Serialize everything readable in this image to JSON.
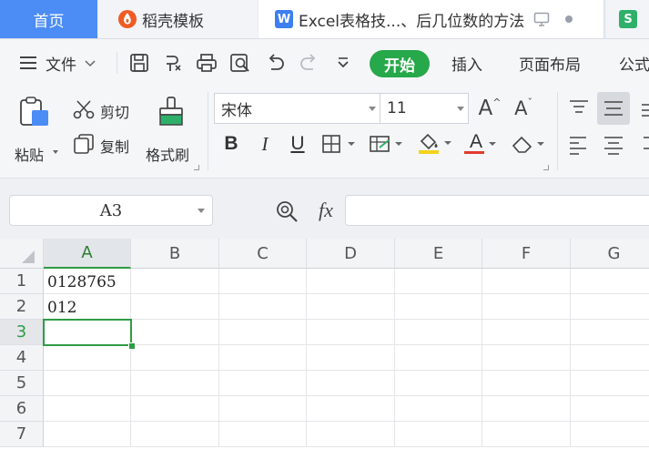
{
  "tabs": [
    {
      "label": "首页"
    },
    {
      "label": "稻壳模板",
      "icon": "daoke-logo-icon"
    },
    {
      "label": "Excel表格技...、后几位数的方法",
      "icon": "wps-writer-icon"
    },
    {
      "label": "S",
      "icon": "wps-sheet-icon"
    }
  ],
  "menu": {
    "file_label": "文件",
    "start_label": "开始",
    "insert_label": "插入",
    "page_layout_label": "页面布局",
    "formula_label_partial": "公式"
  },
  "ribbon": {
    "paste_label": "粘贴",
    "cut_label": "剪切",
    "copy_label": "复制",
    "format_painter_label": "格式刷",
    "font_name": "宋体",
    "font_size": "11",
    "bold": "B",
    "italic": "I",
    "underline": "U",
    "font_color_glyph": "A",
    "grow_font_glyph": "A",
    "shrink_font_glyph": "A"
  },
  "formula_bar": {
    "name_box": "A3",
    "fx_label": "fx",
    "formula_value": ""
  },
  "sheet": {
    "columns": [
      "A",
      "B",
      "C",
      "D",
      "E",
      "F",
      "G"
    ],
    "rows": [
      "1",
      "2",
      "3",
      "4",
      "5",
      "6",
      "7"
    ],
    "cells": {
      "A1": "0128765",
      "A2": "012"
    },
    "active_cell": "A3"
  },
  "colors": {
    "accent_green": "#27a84a",
    "home_tab_blue": "#4b8cf5",
    "selection_green": "#2e9c45"
  }
}
